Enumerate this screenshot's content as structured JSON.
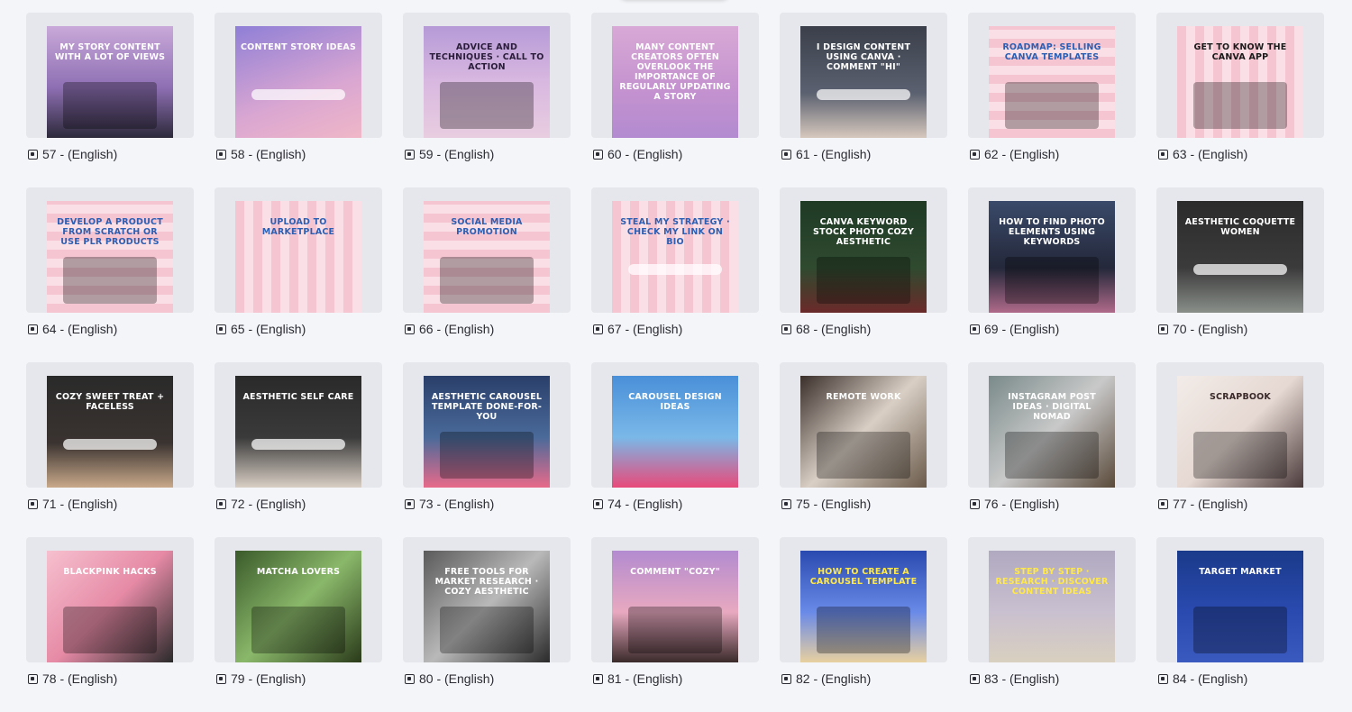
{
  "template_icon": "template-icon",
  "items": [
    {
      "caption": "57 - (English)",
      "title": "My story content with a lot of views",
      "bg": "linear-gradient(180deg,#c9a9d9 0%,#8e6fb3 55%,#2d2a3b 100%)",
      "fg": "#ffffff",
      "deco": "photo"
    },
    {
      "caption": "58 - (English)",
      "title": "Content story ideas",
      "bg": "linear-gradient(160deg,#8f7fd6 0%,#d9a6d2 60%,#f0b7c7 100%)",
      "fg": "#ffffff",
      "deco": "pill"
    },
    {
      "caption": "59 - (English)",
      "title": "Advice and techniques · Call to action",
      "bg": "linear-gradient(180deg,#b59ad7 0%,#d9b8e0 50%,#e8cde0 100%)",
      "fg": "#2a1d3a",
      "deco": "photo"
    },
    {
      "caption": "60 - (English)",
      "title": "Many content creators often overlook the importance of regularly updating a story",
      "bg": "linear-gradient(180deg,#d8a9d6 0%,#c391cf 60%,#b38bd0 100%)",
      "fg": "#ffffff",
      "deco": "none"
    },
    {
      "caption": "61 - (English)",
      "title": "I design content using Canva · Comment \"Hi\"",
      "bg": "linear-gradient(180deg,#3a3f4a 0%,#5b6170 60%,#d7c8bd 100%)",
      "fg": "#ffffff",
      "deco": "pill"
    },
    {
      "caption": "62 - (English)",
      "title": "Roadmap: Selling Canva Templates",
      "bg": "repeating-linear-gradient(0deg,#f6c5d2 0 10px,#fbdfe6 10px 20px)",
      "fg": "#2c5fb3",
      "deco": "photo"
    },
    {
      "caption": "63 - (English)",
      "title": "Get to know the Canva app",
      "bg": "repeating-linear-gradient(90deg,#f6c5d2 0 10px,#fbdfe6 10px 20px)",
      "fg": "#1a1a1a",
      "deco": "photo"
    },
    {
      "caption": "64 - (English)",
      "title": "Develop a product from scratch or use PLR products",
      "bg": "repeating-linear-gradient(0deg,#f6c5d2 0 10px,#fbdfe6 10px 20px)",
      "fg": "#2c5fb3",
      "deco": "photo"
    },
    {
      "caption": "65 - (English)",
      "title": "Upload to marketplace",
      "bg": "repeating-linear-gradient(90deg,#f6c5d2 0 10px,#fbdfe6 10px 20px)",
      "fg": "#2c5fb3",
      "deco": "none"
    },
    {
      "caption": "66 - (English)",
      "title": "Social media promotion",
      "bg": "repeating-linear-gradient(0deg,#f6c5d2 0 10px,#fbdfe6 10px 20px)",
      "fg": "#2c5fb3",
      "deco": "photo"
    },
    {
      "caption": "67 - (English)",
      "title": "Steal my strategy · Check my link on bio",
      "bg": "repeating-linear-gradient(90deg,#f6c5d2 0 10px,#fbdfe6 10px 20px)",
      "fg": "#2c5fb3",
      "deco": "pill"
    },
    {
      "caption": "68 - (English)",
      "title": "Canva keyword stock photo cozy aesthetic",
      "bg": "linear-gradient(180deg,#1f3a25 0%,#2f4a2f 60%,#6b2a2a 100%)",
      "fg": "#ffffff",
      "deco": "photo"
    },
    {
      "caption": "69 - (English)",
      "title": "How to find photo elements using keywords",
      "bg": "linear-gradient(180deg,#3a4a6a 0%,#24283a 60%,#b06a8a 100%)",
      "fg": "#ffffff",
      "deco": "photo"
    },
    {
      "caption": "70 - (English)",
      "title": "Aesthetic coquette women",
      "bg": "linear-gradient(180deg,#2b2b2b 0%,#3b3b3b 60%,#8a8f8a 100%)",
      "fg": "#ffffff",
      "deco": "pill"
    },
    {
      "caption": "71 - (English)",
      "title": "Cozy sweet treat + faceless",
      "bg": "linear-gradient(180deg,#2a2a2a 0%,#3a3330 60%,#c9a98a 100%)",
      "fg": "#ffffff",
      "deco": "pill"
    },
    {
      "caption": "72 - (English)",
      "title": "Aesthetic self care",
      "bg": "linear-gradient(180deg,#2a2a2a 0%,#3a3a3a 55%,#d9cfc5 100%)",
      "fg": "#ffffff",
      "deco": "pill"
    },
    {
      "caption": "73 - (English)",
      "title": "Aesthetic carousel template done-for-you",
      "bg": "linear-gradient(180deg,#2a3f6a 0%,#4a6a9a 55%,#e86a8a 100%)",
      "fg": "#ffffff",
      "deco": "photo"
    },
    {
      "caption": "74 - (English)",
      "title": "Carousel design ideas",
      "bg": "linear-gradient(180deg,#4a90d9 0%,#7ab8e8 55%,#e84a7a 100%)",
      "fg": "#ffffff",
      "deco": "none"
    },
    {
      "caption": "75 - (English)",
      "title": "Remote work",
      "bg": "linear-gradient(135deg,#3a2f2a 0%,#d9cfc5 50%,#6a5a4a 100%)",
      "fg": "#ffffff",
      "deco": "photo"
    },
    {
      "caption": "76 - (English)",
      "title": "Instagram post ideas · Digital nomad",
      "bg": "linear-gradient(135deg,#7a8a8a 0%,#c9c9c9 50%,#5a4a3a 100%)",
      "fg": "#ffffff",
      "deco": "photo"
    },
    {
      "caption": "77 - (English)",
      "title": "Scrapbook",
      "bg": "linear-gradient(135deg,#f2ece8 0%,#e6d8d2 50%,#4a3a3a 100%)",
      "fg": "#3a2a2a",
      "deco": "photo"
    },
    {
      "caption": "78 - (English)",
      "title": "Blackpink hacks",
      "bg": "linear-gradient(135deg,#f6c0cf 0%,#e68aa6 50%,#2a2a2a 100%)",
      "fg": "#ffffff",
      "deco": "photo"
    },
    {
      "caption": "79 - (English)",
      "title": "Matcha lovers",
      "bg": "linear-gradient(135deg,#3a5a2a 0%,#8ab86a 50%,#2a3a1a 100%)",
      "fg": "#ffffff",
      "deco": "photo"
    },
    {
      "caption": "80 - (English)",
      "title": "Free tools for market research · Cozy aesthetic",
      "bg": "linear-gradient(135deg,#5a5a5a 0%,#b9b9b9 50%,#2a2a2a 100%)",
      "fg": "#ffffff",
      "deco": "photo"
    },
    {
      "caption": "81 - (English)",
      "title": "Comment \"Cozy\"",
      "bg": "linear-gradient(180deg,#b38bd0 0%,#e8a9c0 55%,#3a2a2a 100%)",
      "fg": "#ffffff",
      "deco": "photo"
    },
    {
      "caption": "82 - (English)",
      "title": "How to create a carousel template",
      "bg": "linear-gradient(180deg,#2a4ab0 0%,#6a8ae8 55%,#e8d0a0 100%)",
      "fg": "#ffe84a",
      "deco": "photo"
    },
    {
      "caption": "83 - (English)",
      "title": "Step by step · Research · Discover content ideas",
      "bg": "linear-gradient(180deg,#b0a9c0 0%,#c9c0d0 55%,#d9d0c0 100%)",
      "fg": "#ffe84a",
      "deco": "none"
    },
    {
      "caption": "84 - (English)",
      "title": "Target market",
      "bg": "linear-gradient(180deg,#1a3a8a 0%,#2a4ab0 55%,#3a5ac0 100%)",
      "fg": "#ffffff",
      "deco": "photo"
    }
  ]
}
